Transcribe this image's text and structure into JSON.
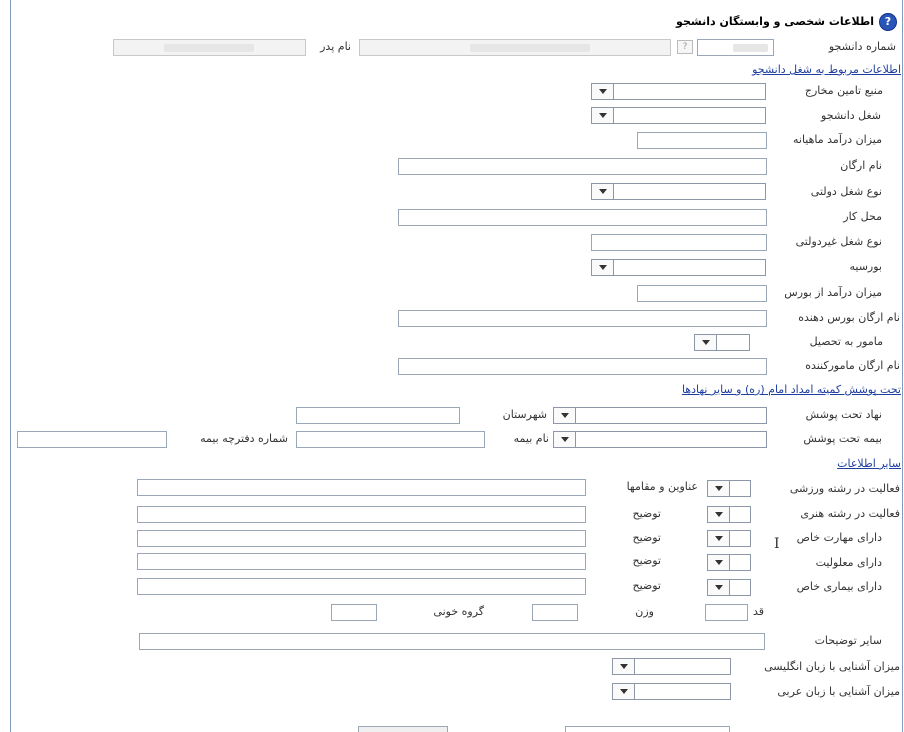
{
  "header": {
    "title": "اطلاعات شخصی و وابستگان دانشجو",
    "help_icon_glyph": "?"
  },
  "student": {
    "student_number_label": "شماره دانشجو",
    "father_name_label": "نام پدر",
    "lookup_glyph": "?"
  },
  "sections": {
    "job": "اطلاعات مربوط به شغل دانشجو",
    "coverage": "تحت پوشش کمیته امداد امام (ره) و سایر نهادها",
    "other": "سایر اطلاعات"
  },
  "job": {
    "funding_source_label": "منبع تامین مخارج",
    "student_job_label": "شغل دانشجو",
    "monthly_income_label": "میزان درآمد ماهیانه",
    "org_name_label": "نام ارگان",
    "gov_job_type_label": "نوع شغل دولتی",
    "workplace_label": "محل کار",
    "nongov_job_type_label": "نوع شغل غیردولتی",
    "scholarship_label": "بورسیه",
    "scholarship_income_label": "میزان درآمد از بورس",
    "scholarship_org_label": "نام ارگان بورس دهنده",
    "assigned_to_study_label": "مامور به تحصیل",
    "assigning_org_label": "نام ارگان مامورکننده"
  },
  "coverage": {
    "covering_org_label": "نهاد تحت پوشش",
    "city_label": "شهرستان",
    "insurance_label": "بیمه تحت پوشش",
    "insurance_name_label": "نام بیمه",
    "insurance_book_label": "شماره دفترچه بیمه"
  },
  "other": {
    "sports_label": "فعالیت در رشته ورزشی",
    "titles_label": "عناوین و مقامها",
    "art_label": "فعالیت در رشته هنری",
    "skill_label": "دارای مهارت خاص",
    "disability_label": "دارای معلولیت",
    "illness_label": "دارای بیماری خاص",
    "description_label": "توضیح",
    "height_label": "قد",
    "weight_label": "وزن",
    "blood_group_label": "گروه خونی",
    "other_notes_label": "سایر توضیحات",
    "english_label": "میزان آشنایی با زبان انگلیسی",
    "arabic_label": "میزان آشنایی با زبان عربی"
  },
  "colors": {
    "section_link": "#1f3fa0",
    "frame": "#7f9db9",
    "help_icon": "#2a55b8"
  }
}
